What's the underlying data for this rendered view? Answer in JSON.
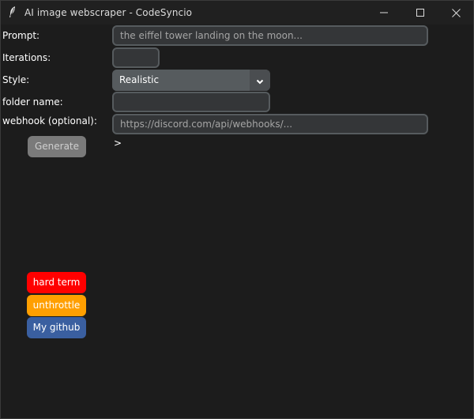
{
  "window": {
    "title": "AI image webscraper - CodeSyncio",
    "controls": {
      "minimize_icon": "minimize-icon",
      "maximize_icon": "maximize-icon",
      "close_icon": "close-icon"
    }
  },
  "form": {
    "prompt": {
      "label": "Prompt:",
      "value": "",
      "placeholder": "the eiffel tower landing on the moon..."
    },
    "iterations": {
      "label": "Iterations:",
      "value": "",
      "placeholder": ""
    },
    "style": {
      "label": "Style:",
      "selected": "Realistic",
      "icon": "chevron-down-icon"
    },
    "folder_name": {
      "label": "folder name:",
      "value": "",
      "placeholder": ""
    },
    "webhook": {
      "label": "webhook (optional):",
      "value": "",
      "placeholder": "https://discord.com/api/webhooks/..."
    }
  },
  "buttons": {
    "generate": "Generate",
    "hard_term": "hard term",
    "unthrottle": "unthrottle",
    "github": "My github"
  },
  "output": {
    "prompt_text": ">"
  },
  "colors": {
    "background": "#1c1c1c",
    "titlebar": "#202020",
    "entry_bg": "#343638",
    "entry_border": "#565b5e",
    "generate": "#7a7a7a",
    "hard_term": "#ff0000",
    "unthrottle": "#ff9f00",
    "github": "#3a5fa0"
  }
}
